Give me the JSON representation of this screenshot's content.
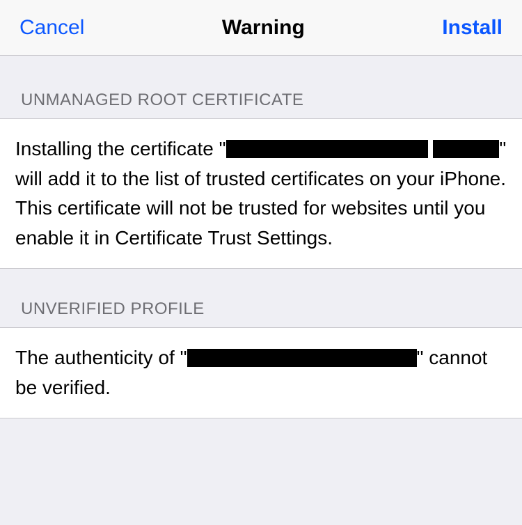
{
  "navbar": {
    "cancel_label": "Cancel",
    "title": "Warning",
    "install_label": "Install"
  },
  "sections": {
    "unmanaged_root": {
      "header": "UNMANAGED ROOT CERTIFICATE",
      "body_pre": "Installing the certificate \"",
      "body_post": "\" will add it to the list of trusted certificates on your iPhone. This certificate will not be trusted for websites until you enable it in Certificate Trust Settings."
    },
    "unverified_profile": {
      "header": "UNVERIFIED PROFILE",
      "body_pre": "The authenticity of \"",
      "body_post": "\" cannot be verified."
    }
  }
}
